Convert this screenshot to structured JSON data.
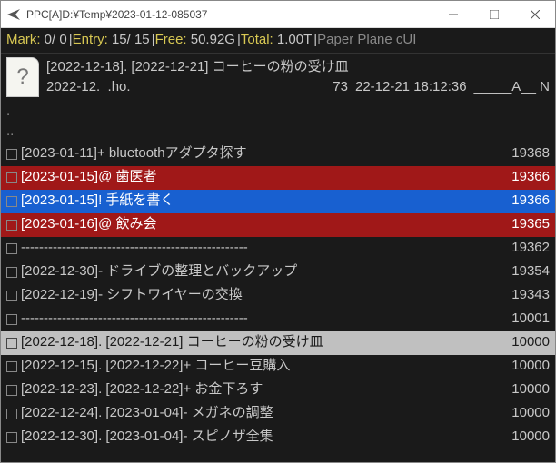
{
  "window": {
    "title": "PPC[A]D:¥Temp¥2023-01-12-085037"
  },
  "status": {
    "mark_label": "Mark:",
    "mark_value": " 0/       0",
    "entry_label": "Entry:",
    "entry_value": " 15/ 15",
    "free_label": "Free:",
    "free_value": "  50.92G",
    "total_label": "Total:",
    "total_value": "   1.00T",
    "app_name": "Paper Plane cUI"
  },
  "header": {
    "line1": "[2022-12-18]. [2022-12-21] コーヒーの粉の受け皿",
    "name": "2022-12.  .ho.",
    "size": "73",
    "datetime": "22-12-21 18:12:36",
    "attrs": "_____A__ N"
  },
  "dir": {
    "dot": ".",
    "dotdot": ".."
  },
  "rows": [
    {
      "name": "[2023-01-11]+ bluetoothアダプタ探す",
      "size": "19368",
      "cls": ""
    },
    {
      "name": "[2023-01-15]@ 歯医者",
      "size": "19366",
      "cls": "red"
    },
    {
      "name": "[2023-01-15]! 手紙を書く",
      "size": "19366",
      "cls": "blue"
    },
    {
      "name": "[2023-01-16]@ 飲み会",
      "size": "19365",
      "cls": "red"
    },
    {
      "name": "--------------------------------------------------",
      "size": "19362",
      "cls": ""
    },
    {
      "name": "[2022-12-30]- ドライブの整理とバックアップ",
      "size": "19354",
      "cls": ""
    },
    {
      "name": "[2022-12-19]- シフトワイヤーの交換",
      "size": "19343",
      "cls": ""
    },
    {
      "name": "--------------------------------------------------",
      "size": "10001",
      "cls": ""
    },
    {
      "name": "[2022-12-18]. [2022-12-21] コーヒーの粉の受け皿",
      "size": "10000",
      "cls": "highlight"
    },
    {
      "name": "[2022-12-15]. [2022-12-22]+ コーヒー豆購入",
      "size": "10000",
      "cls": ""
    },
    {
      "name": "[2022-12-23]. [2022-12-22]+ お金下ろす",
      "size": "10000",
      "cls": ""
    },
    {
      "name": "[2022-12-24]. [2023-01-04]- メガネの調整",
      "size": "10000",
      "cls": ""
    },
    {
      "name": "[2022-12-30]. [2023-01-04]- スピノザ全集",
      "size": "10000",
      "cls": ""
    }
  ]
}
